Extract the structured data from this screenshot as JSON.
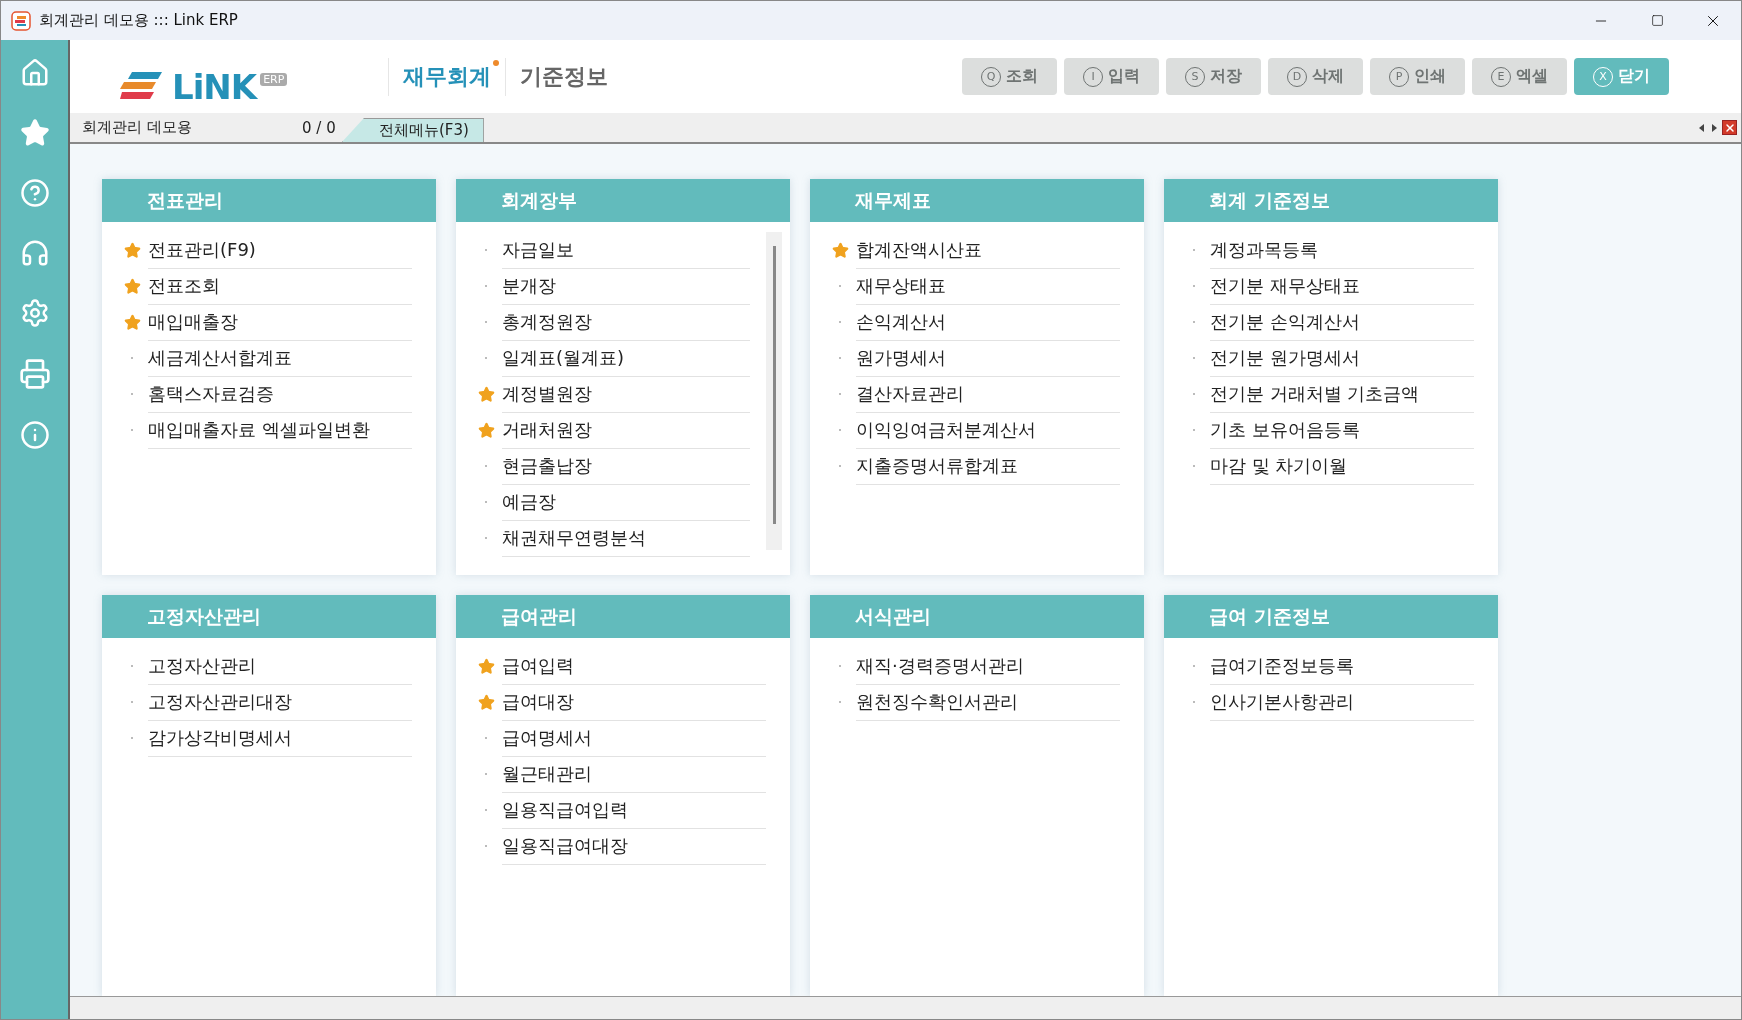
{
  "window": {
    "title": "회계관리 데모용 ::: Link ERP"
  },
  "logo": {
    "text": "LiNK",
    "badge": "ERP"
  },
  "modules": [
    {
      "label": "재무회계",
      "selected": true
    },
    {
      "label": "기준정보",
      "selected": false
    }
  ],
  "toolbar": [
    {
      "key": "Q",
      "label": "조회",
      "disabled": true
    },
    {
      "key": "I",
      "label": "입력",
      "disabled": true
    },
    {
      "key": "S",
      "label": "저장",
      "disabled": true
    },
    {
      "key": "D",
      "label": "삭제",
      "disabled": true
    },
    {
      "key": "P",
      "label": "인쇄",
      "disabled": true
    },
    {
      "key": "E",
      "label": "엑셀",
      "disabled": true
    },
    {
      "key": "X",
      "label": "닫기",
      "disabled": false
    }
  ],
  "tab_strip": {
    "company": "회계관리 데모용",
    "counter": "0 / 0",
    "tabs": [
      {
        "label": "전체메뉴(F3)",
        "selected": true
      }
    ]
  },
  "cards": [
    {
      "title": "전표관리",
      "scrollable": false,
      "items": [
        {
          "label": "전표관리(F9)",
          "favorite": true
        },
        {
          "label": "전표조회",
          "favorite": true
        },
        {
          "label": "매입매출장",
          "favorite": true
        },
        {
          "label": "세금계산서합계표",
          "favorite": false
        },
        {
          "label": "홈택스자료검증",
          "favorite": false
        },
        {
          "label": "매입매출자료 엑셀파일변환",
          "favorite": false
        }
      ]
    },
    {
      "title": "회계장부",
      "scrollable": true,
      "items": [
        {
          "label": "자금일보",
          "favorite": false
        },
        {
          "label": "분개장",
          "favorite": false
        },
        {
          "label": "총계정원장",
          "favorite": false
        },
        {
          "label": "일계표(월계표)",
          "favorite": false
        },
        {
          "label": "계정별원장",
          "favorite": true
        },
        {
          "label": "거래처원장",
          "favorite": true
        },
        {
          "label": "현금출납장",
          "favorite": false
        },
        {
          "label": "예금장",
          "favorite": false
        },
        {
          "label": "채권채무연령분석",
          "favorite": false
        }
      ]
    },
    {
      "title": "재무제표",
      "scrollable": false,
      "items": [
        {
          "label": "합계잔액시산표",
          "favorite": true
        },
        {
          "label": "재무상태표",
          "favorite": false
        },
        {
          "label": "손익계산서",
          "favorite": false
        },
        {
          "label": "원가명세서",
          "favorite": false
        },
        {
          "label": "결산자료관리",
          "favorite": false
        },
        {
          "label": "이익잉여금처분계산서",
          "favorite": false
        },
        {
          "label": "지출증명서류합계표",
          "favorite": false
        }
      ]
    },
    {
      "title": "회계 기준정보",
      "scrollable": false,
      "items": [
        {
          "label": "계정과목등록",
          "favorite": false
        },
        {
          "label": "전기분 재무상태표",
          "favorite": false
        },
        {
          "label": "전기분 손익계산서",
          "favorite": false
        },
        {
          "label": "전기분 원가명세서",
          "favorite": false
        },
        {
          "label": "전기분 거래처별 기초금액",
          "favorite": false
        },
        {
          "label": "기초 보유어음등록",
          "favorite": false
        },
        {
          "label": "마감 및 차기이월",
          "favorite": false
        }
      ]
    },
    {
      "title": "고정자산관리",
      "scrollable": false,
      "items": [
        {
          "label": "고정자산관리",
          "favorite": false
        },
        {
          "label": "고정자산관리대장",
          "favorite": false
        },
        {
          "label": "감가상각비명세서",
          "favorite": false
        }
      ]
    },
    {
      "title": "급여관리",
      "scrollable": false,
      "items": [
        {
          "label": "급여입력",
          "favorite": true
        },
        {
          "label": "급여대장",
          "favorite": true
        },
        {
          "label": "급여명세서",
          "favorite": false
        },
        {
          "label": "월근태관리",
          "favorite": false
        },
        {
          "label": "일용직급여입력",
          "favorite": false
        },
        {
          "label": "일용직급여대장",
          "favorite": false
        }
      ]
    },
    {
      "title": "서식관리",
      "scrollable": false,
      "items": [
        {
          "label": "재직·경력증명서관리",
          "favorite": false
        },
        {
          "label": "원천징수확인서관리",
          "favorite": false
        }
      ]
    },
    {
      "title": "급여 기준정보",
      "scrollable": false,
      "items": [
        {
          "label": "급여기준정보등록",
          "favorite": false
        },
        {
          "label": "인사기본사항관리",
          "favorite": false
        }
      ]
    }
  ]
}
